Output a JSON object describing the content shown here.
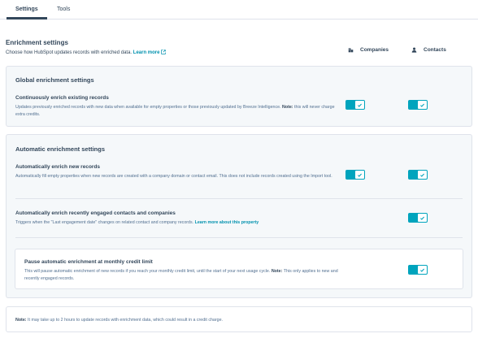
{
  "tabs": [
    {
      "label": "Settings",
      "active": true
    },
    {
      "label": "Tools",
      "active": false
    }
  ],
  "header": {
    "title": "Enrichment settings",
    "description": "Choose how HubSpot updates records with enriched data.",
    "learn_more": "Learn more"
  },
  "columns": {
    "companies": "Companies",
    "contacts": "Contacts"
  },
  "global": {
    "title": "Global enrichment settings",
    "continuous": {
      "title": "Continuously enrich existing records",
      "desc_line1": "Updates previously enriched records with new data when available for empty properties or those previously updated by Breeze Intelligence.",
      "note_label": "Note:",
      "desc_line1_end": "this",
      "desc_line2": "will never charge extra credits.",
      "companies_on": true,
      "contacts_on": true
    }
  },
  "automatic": {
    "title": "Automatic enrichment settings",
    "new_records": {
      "title": "Automatically enrich new records",
      "desc_line1": "Automatically fill empty properties when new records are created with a company domain or contact email. This does not include records created",
      "desc_line2": "using the Import tool.",
      "companies_on": true,
      "contacts_on": true
    },
    "engaged": {
      "title": "Automatically enrich recently engaged contacts and companies",
      "desc": "Triggers when the \"Last engagement date\" changes on related contact and company records.",
      "learn_more": "Learn more about this property",
      "contacts_on": true
    },
    "pause": {
      "title": "Pause automatic enrichment at monthly credit limit",
      "desc_line1": "This will pause automatic enrichment of new records if you reach your monthly credit limit, until the start of your next usage cycle.",
      "note_label": "Note:",
      "desc_line1_end": "This only",
      "desc_line2": "applies to new and recently engaged records.",
      "contacts_on": true
    }
  },
  "footer_note": {
    "label": "Note:",
    "text": "It may take up to 2 hours to update records with enrichment data, which could result in a credit charge."
  },
  "colors": {
    "toggle_on": "#00a4bd",
    "link": "#0091ae",
    "text": "#33475b",
    "panel": "#f5f8fa"
  },
  "icons": {
    "companies": "building-icon",
    "contacts": "person-icon",
    "external": "external-link-icon",
    "check": "check-icon"
  }
}
